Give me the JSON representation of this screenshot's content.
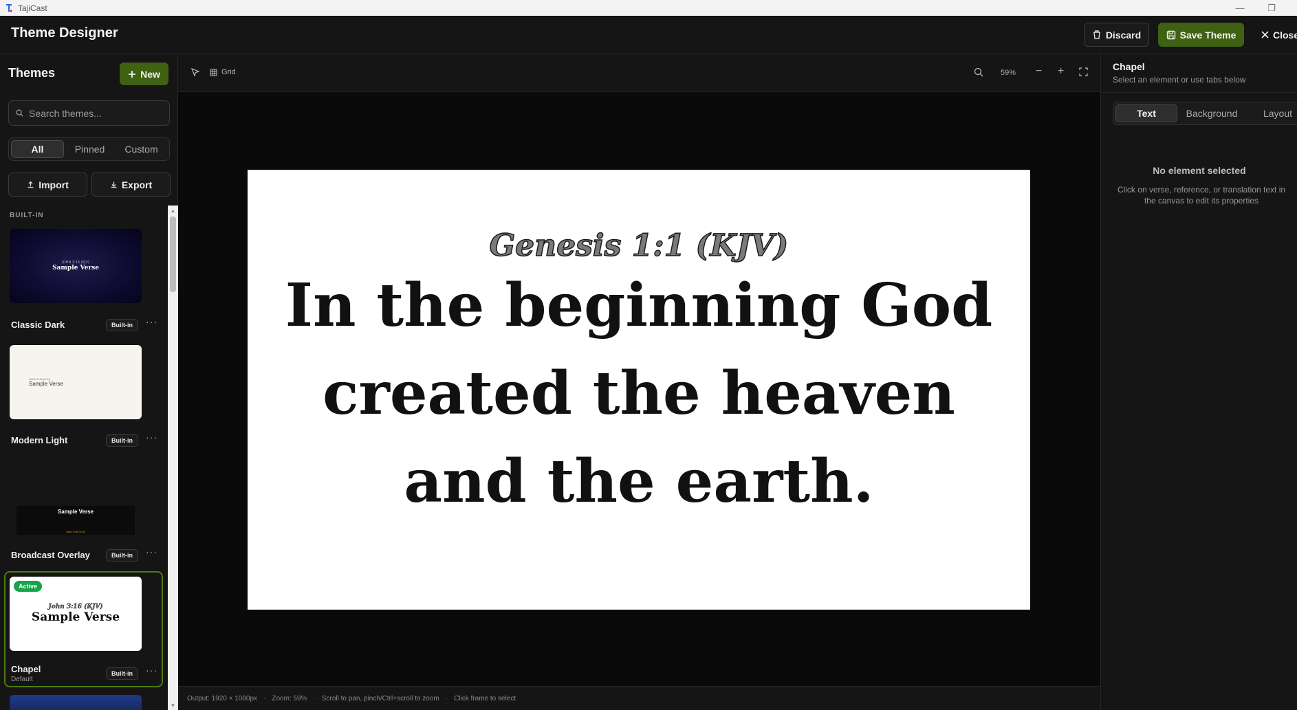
{
  "os_window": {
    "app_title": "TajiCast",
    "minimize_glyph": "—",
    "maximize_glyph": "❐"
  },
  "header": {
    "title": "Theme Designer",
    "discard_label": "Discard",
    "save_label": "Save Theme",
    "close_label": "Close"
  },
  "sidebar": {
    "title": "Themes",
    "new_label": "New",
    "search_placeholder": "Search themes...",
    "filters": [
      "All",
      "Pinned",
      "Custom"
    ],
    "active_filter": "All",
    "import_label": "Import",
    "export_label": "Export",
    "section_label": "BUILT-IN",
    "themes": [
      {
        "name": "Classic Dark",
        "badge": "Built-in",
        "preview_reference": "JOHN 3:16 (KJV)",
        "preview_verse": "Sample Verse",
        "sub": ""
      },
      {
        "name": "Modern Light",
        "badge": "Built-in",
        "preview_reference": "JOHN 3:16 (KJV)",
        "preview_verse": "Sample Verse",
        "sub": ""
      },
      {
        "name": "Broadcast Overlay",
        "badge": "Built-in",
        "preview_reference": "John 3:16 (KJV)",
        "preview_verse": "Sample Verse",
        "sub": ""
      },
      {
        "name": "Chapel",
        "badge": "Built-in",
        "preview_reference": "John 3:16 (KJV)",
        "preview_verse": "Sample Verse",
        "sub": "Default",
        "status": "Active"
      }
    ]
  },
  "toolbar": {
    "grid_label": "Grid",
    "zoom_level": "59%"
  },
  "canvas": {
    "reference": "Genesis 1:1 (KJV)",
    "verse_lines": [
      "In the beginning God",
      "created the heaven",
      "and the earth."
    ]
  },
  "status_bar": {
    "output": "Output: 1920 × 1080px",
    "zoom": "Zoom: 59%",
    "hint_pan": "Scroll to pan, pinch/Ctrl+scroll to zoom",
    "hint_select": "Click frame to select"
  },
  "right_panel": {
    "title": "Chapel",
    "subtitle": "Select an element or use tabs below",
    "tabs": [
      "Text",
      "Background",
      "Layout"
    ],
    "active_tab": "Text",
    "empty_title": "No element selected",
    "empty_desc": "Click on verse, reference, or translation text in the canvas to edit its properties"
  },
  "colors": {
    "accent_green": "#3f6212",
    "active_badge": "#16a34a",
    "app_bg": "#151515",
    "canvas_bg": "#0a0a0a"
  }
}
